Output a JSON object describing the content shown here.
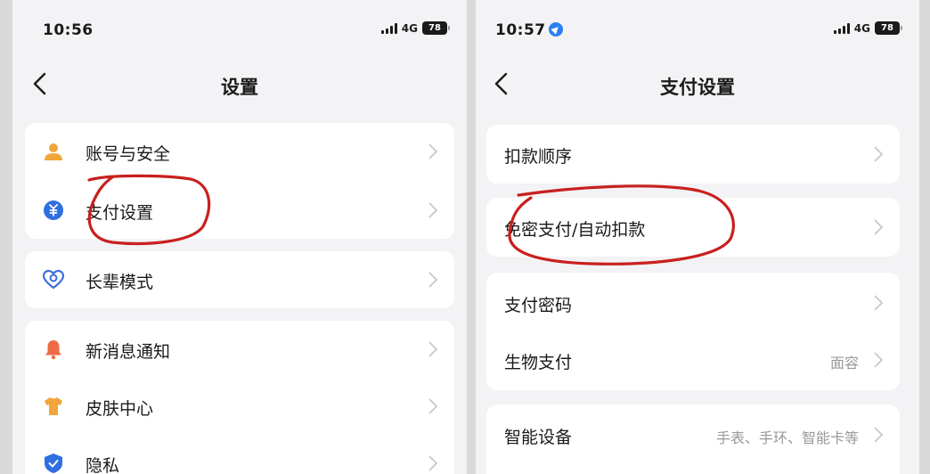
{
  "left_screen": {
    "status": {
      "time": "10:56",
      "network": "4G",
      "battery": "78"
    },
    "title": "设置",
    "groups": [
      [
        {
          "label": "账号与安全",
          "icon": "person-icon",
          "color": "#f2a53a"
        },
        {
          "label": "支付设置",
          "icon": "wallet-icon",
          "color": "#2f6fe0"
        }
      ],
      [
        {
          "label": "长辈模式",
          "icon": "heart-icon",
          "color": "#3d6fd8"
        }
      ],
      [
        {
          "label": "新消息通知",
          "icon": "bell-icon",
          "color": "#f06a45"
        },
        {
          "label": "皮肤中心",
          "icon": "shirt-icon",
          "color": "#f2a53a"
        },
        {
          "label": "隐私",
          "icon": "shield-icon",
          "color": "#2f6fe0"
        }
      ]
    ]
  },
  "right_screen": {
    "status": {
      "time": "10:57",
      "network": "4G",
      "battery": "78"
    },
    "title": "支付设置",
    "groups": [
      [
        {
          "label": "扣款顺序",
          "value": ""
        }
      ],
      [
        {
          "label": "免密支付/自动扣款",
          "value": ""
        }
      ],
      [
        {
          "label": "支付密码",
          "value": ""
        },
        {
          "label": "生物支付",
          "value": "面容"
        }
      ],
      [
        {
          "label": "智能设备",
          "value": "手表、手环、智能卡等"
        }
      ]
    ]
  },
  "colors": {
    "annotation": "#c8201e",
    "background": "#f3f3f5",
    "card": "#ffffff"
  }
}
